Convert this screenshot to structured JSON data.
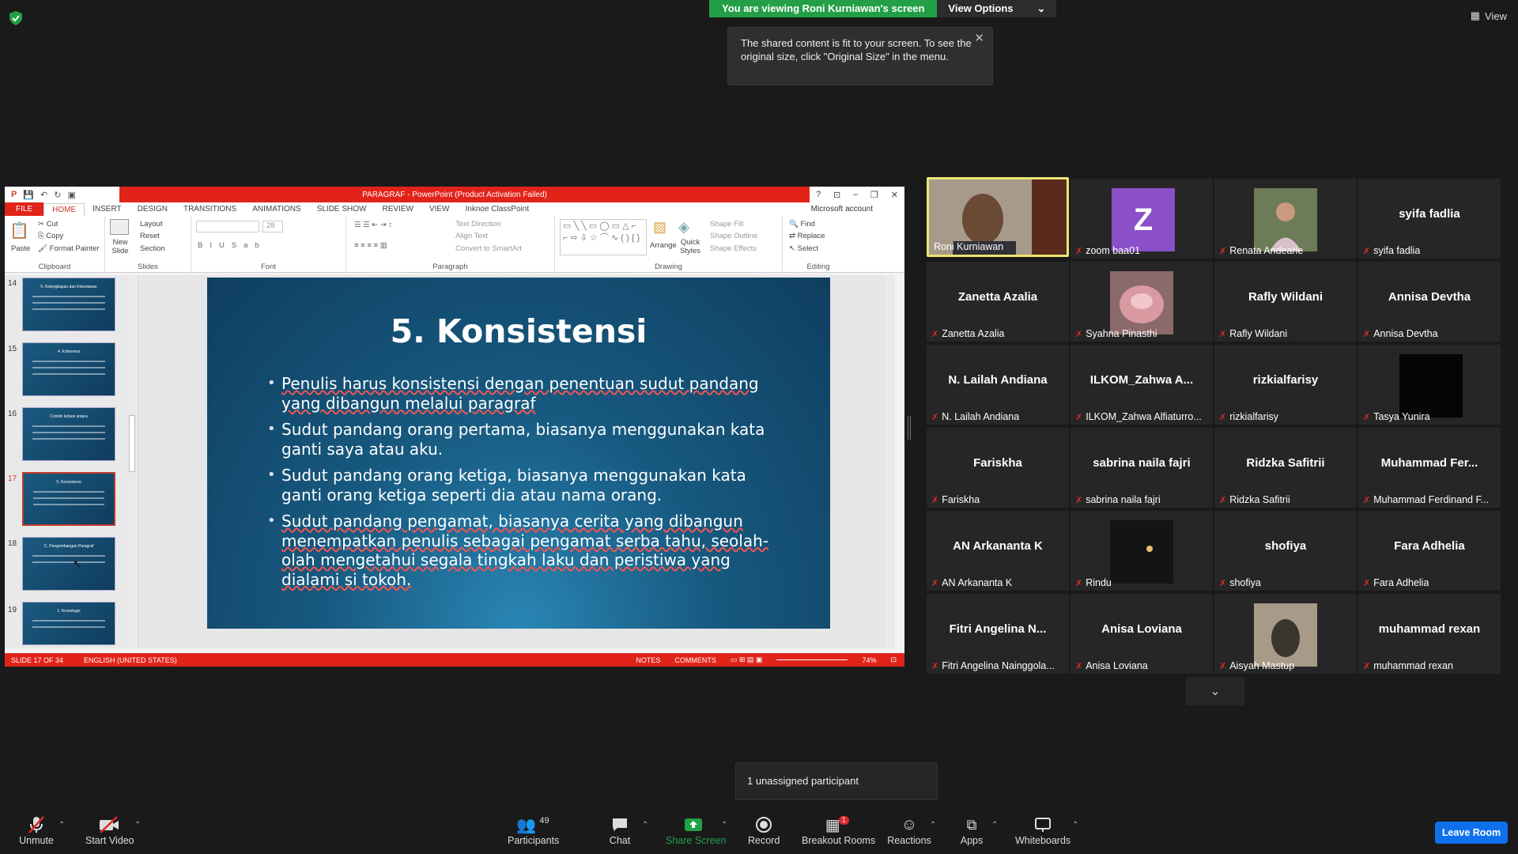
{
  "banner": {
    "viewing": "You are viewing Roni Kurniawan's screen",
    "view_options": "View Options",
    "view": "View"
  },
  "tooltip": {
    "text": "The shared content is fit to your screen. To see the original size, click \"Original Size\" in the menu.",
    "close": "✕"
  },
  "ppt": {
    "title": "PARAGRAF - PowerPoint (Product Activation Failed)",
    "tabs": [
      "FILE",
      "HOME",
      "INSERT",
      "DESIGN",
      "TRANSITIONS",
      "ANIMATIONS",
      "SLIDE SHOW",
      "REVIEW",
      "VIEW",
      "Inknoe ClassPoint"
    ],
    "account": "Microsoft account",
    "ribbon": {
      "paste": "Paste",
      "cut": "Cut",
      "copy": "Copy",
      "format_painter": "Format Painter",
      "clipboard": "Clipboard",
      "new_slide": "New Slide",
      "layout": "Layout",
      "reset": "Reset",
      "section": "Section",
      "slides": "Slides",
      "font_size": "28",
      "font": "Font",
      "paragraph": "Paragraph",
      "text_direction": "Text Direction",
      "align_text": "Align Text",
      "convert_smartart": "Convert to SmartArt",
      "arrange": "Arrange",
      "quick_styles": "Quick Styles",
      "shape_fill": "Shape Fill",
      "shape_outline": "Shape Outline",
      "shape_effects": "Shape Effects",
      "drawing": "Drawing",
      "find": "Find",
      "replace": "Replace",
      "select": "Select",
      "editing": "Editing"
    },
    "thumbnails": [
      {
        "num": "14",
        "title": "5. Kelengkapan dan Ketuntasan"
      },
      {
        "num": "15",
        "title": "4. Koherensi"
      },
      {
        "num": "16",
        "title": "Contoh kohesi antara"
      },
      {
        "num": "17",
        "title": "5. Konsistensi"
      },
      {
        "num": "18",
        "title": "C. Pengembangan Paragraf"
      },
      {
        "num": "19",
        "title": "1. Kronologis"
      }
    ],
    "slide": {
      "title": "5. Konsistensi",
      "bullets": [
        "Penulis harus konsistensi dengan penentuan sudut pandang yang dibangun melalui paragraf",
        "Sudut pandang orang pertama, biasanya menggunakan kata ganti saya atau aku.",
        "Sudut pandang orang ketiga, biasanya menggunakan kata ganti orang ketiga seperti dia atau nama orang.",
        "Sudut pandang pengamat, biasanya cerita yang dibangun menempatkan penulis sebagai pengamat serba tahu, seolah-olah mengetahui segala tingkah laku dan peristiwa yang dialami si tokoh."
      ]
    },
    "status": {
      "slide": "SLIDE 17 OF 34",
      "language": "ENGLISH (UNITED STATES)",
      "notes": "NOTES",
      "comments": "COMMENTS",
      "zoom": "74%"
    }
  },
  "participants": [
    {
      "big": "",
      "name": "Roni Kurniawan",
      "muted": false
    },
    {
      "big": "Z",
      "name": "zoom baa01",
      "muted": true
    },
    {
      "big": "",
      "name": "Renata Andearie",
      "muted": true
    },
    {
      "big": "syifa fadlia",
      "name": "syifa fadlia",
      "muted": true
    },
    {
      "big": "Zanetta Azalia",
      "name": "Zanetta Azalia",
      "muted": true
    },
    {
      "big": "",
      "name": "Syahna Pinasthi",
      "muted": true
    },
    {
      "big": "Rafly Wildani",
      "name": "Rafly Wildani",
      "muted": true
    },
    {
      "big": "Annisa Devtha",
      "name": "Annisa Devtha",
      "muted": true
    },
    {
      "big": "N. Lailah Andiana",
      "name": "N. Lailah Andiana",
      "muted": true
    },
    {
      "big": "ILKOM_Zahwa A...",
      "name": "ILKOM_Zahwa Alfiaturro...",
      "muted": true
    },
    {
      "big": "rizkialfarisy",
      "name": "rizkialfarisy",
      "muted": true
    },
    {
      "big": "",
      "name": "Tasya Yunira",
      "muted": true
    },
    {
      "big": "Fariskha",
      "name": "Fariskha",
      "muted": true
    },
    {
      "big": "sabrina naila fajri",
      "name": "sabrina naila fajri",
      "muted": true
    },
    {
      "big": "Ridzka Safitrii",
      "name": "Ridzka Safitrii",
      "muted": true
    },
    {
      "big": "Muhammad Fer...",
      "name": "Muhammad Ferdinand F...",
      "muted": true
    },
    {
      "big": "AN Arkananta K",
      "name": "AN Arkananta K",
      "muted": true
    },
    {
      "big": "",
      "name": "Rindu",
      "muted": true
    },
    {
      "big": "shofiya",
      "name": "shofiya",
      "muted": true
    },
    {
      "big": "Fara Adhelia",
      "name": "Fara Adhelia",
      "muted": true
    },
    {
      "big": "Fitri Angelina N...",
      "name": "Fitri Angelina Nainggola...",
      "muted": true
    },
    {
      "big": "Anisa Loviana",
      "name": "Anisa Loviana",
      "muted": true
    },
    {
      "big": "",
      "name": "Aisyah Mastup",
      "muted": true
    },
    {
      "big": "muhammad rexan",
      "name": "muhammad rexan",
      "muted": true
    }
  ],
  "unassigned": "1 unassigned participant",
  "toolbar": {
    "unmute": "Unmute",
    "start_video": "Start Video",
    "participants": "Participants",
    "participant_count": "49",
    "chat": "Chat",
    "share_screen": "Share Screen",
    "record": "Record",
    "breakout_rooms": "Breakout Rooms",
    "breakout_badge": "1",
    "reactions": "Reactions",
    "apps": "Apps",
    "whiteboards": "Whiteboards",
    "leave": "Leave Room"
  },
  "colors": {
    "share_green": "#23a047",
    "ppt_red": "#e2231a",
    "leave_blue": "#0e71eb",
    "speaker_border": "#ece574",
    "muted_red": "#e02828"
  }
}
